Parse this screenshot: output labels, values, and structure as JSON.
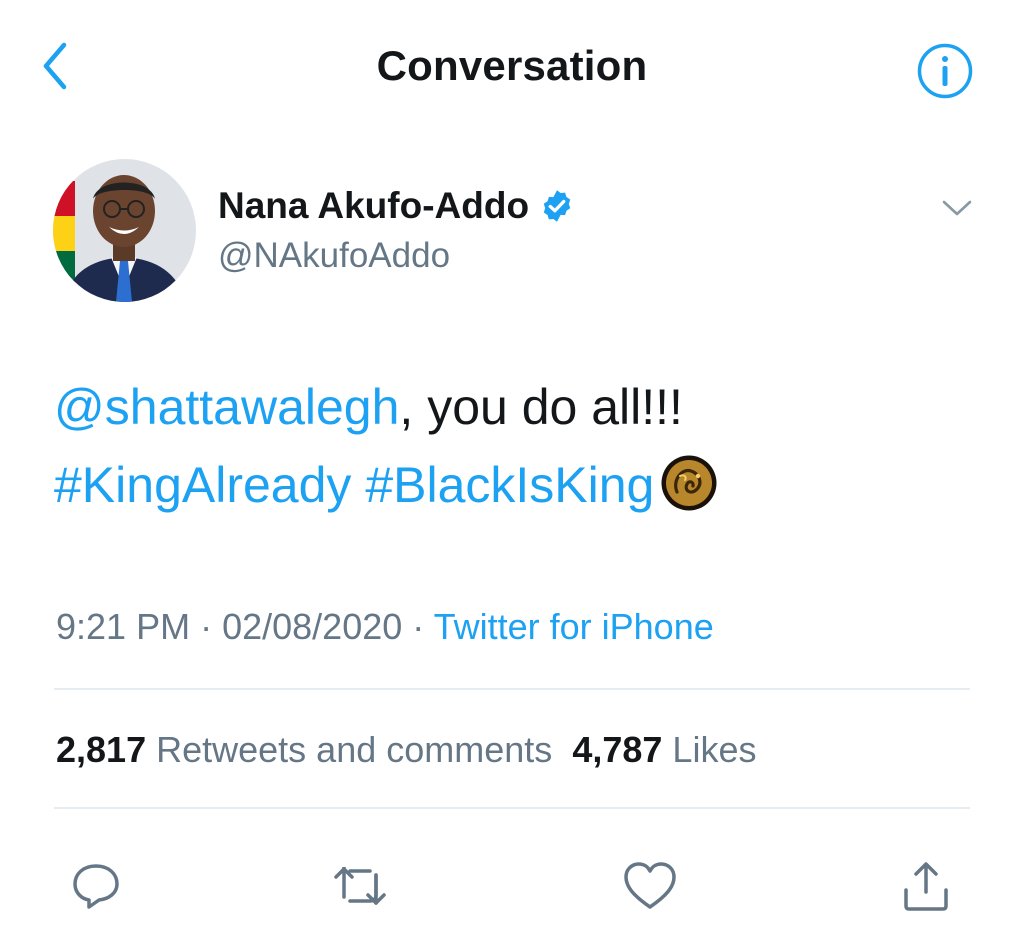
{
  "header": {
    "title": "Conversation",
    "back_icon": "chevron-left-icon",
    "info_icon": "info-icon"
  },
  "author": {
    "name": "Nana Akufo-Addo",
    "handle": "@NAkufoAddo",
    "verified": true,
    "verified_icon": "verified-badge-icon"
  },
  "tweet": {
    "mention": "@shattawalegh",
    "text_after_mention": ", you do all!!!",
    "hashtag_1": "#KingAlready",
    "hashtag_2": "#BlackIsKing",
    "emoji": "black-is-king-hashflag-icon"
  },
  "meta": {
    "time": "9:21 PM",
    "separator_1": " · ",
    "date": "02/08/2020",
    "separator_2": " · ",
    "source": "Twitter for iPhone"
  },
  "stats": {
    "retweets_count": "2,817",
    "retweets_label": "Retweets and comments",
    "likes_count": "4,787",
    "likes_label": "Likes"
  },
  "actions": [
    "reply-icon",
    "retweet-icon",
    "like-icon",
    "share-icon"
  ],
  "colors": {
    "accent": "#1da1f2",
    "text": "#14171a",
    "secondary": "#657786",
    "divider": "#e6ecf0"
  }
}
